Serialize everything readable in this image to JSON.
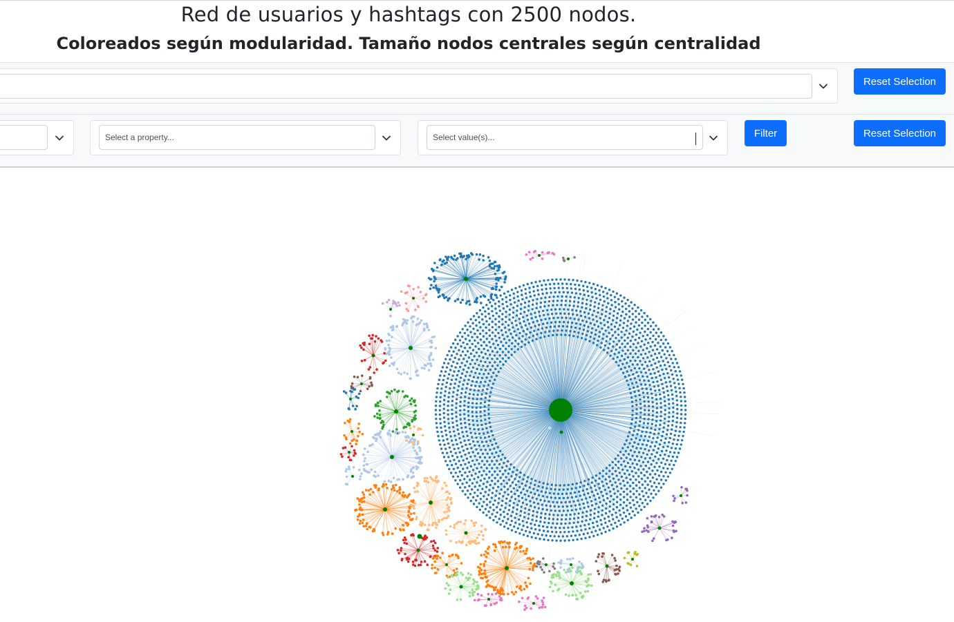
{
  "header": {
    "title": "Red de usuarios y hashtags con 2500 nodos.",
    "subtitle": "Coloreados según modularidad. Tamaño nodos centrales según centralidad"
  },
  "search_bar": {
    "node_search_value": "",
    "reset_label": "Reset Selection"
  },
  "filter_bar": {
    "category_value": "",
    "property_placeholder": "Select a property...",
    "value_placeholder": "Select value(s)...",
    "filter_label": "Filter",
    "reset_label": "Reset Selection"
  },
  "graph": {
    "central_color": "#008000",
    "community_colors": [
      "#1f77b4",
      "#aec7e8",
      "#ff7f0e",
      "#ffbb78",
      "#2ca02c",
      "#98df8a",
      "#d62728",
      "#ff9896",
      "#9467bd",
      "#c5b0d5",
      "#8c564b",
      "#e377c2",
      "#f7b6d2",
      "#bcbd22",
      "#17becf",
      "#7f7f7f"
    ],
    "accent": "#0d6efd"
  }
}
